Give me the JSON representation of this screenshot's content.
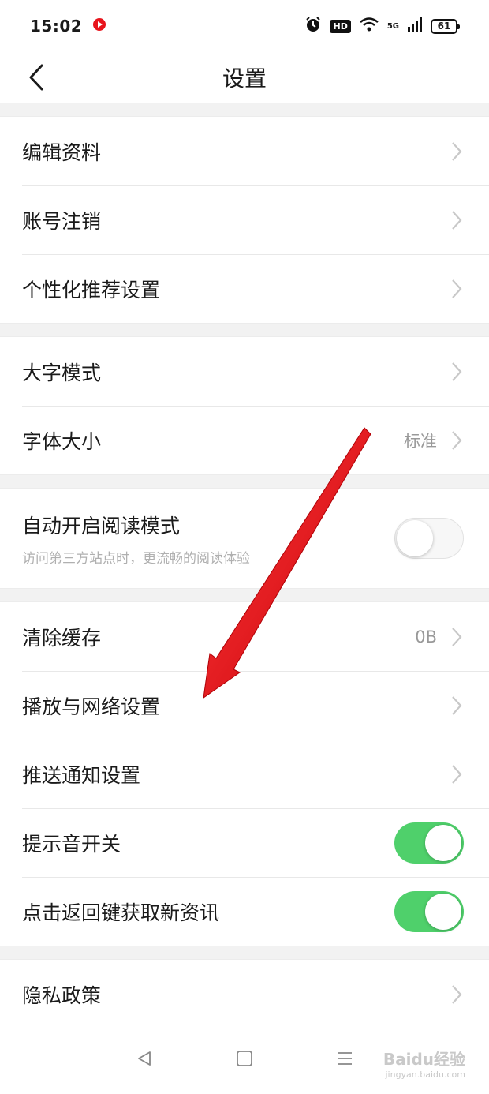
{
  "status": {
    "time": "15:02",
    "hd": "HD",
    "network": "5G",
    "battery": "61"
  },
  "nav": {
    "title": "设置"
  },
  "groups": {
    "g1": [
      {
        "label": "编辑资料"
      },
      {
        "label": "账号注销"
      },
      {
        "label": "个性化推荐设置"
      }
    ],
    "g2": [
      {
        "label": "大字模式"
      },
      {
        "label": "字体大小",
        "value": "标准"
      }
    ],
    "g3": {
      "label": "自动开启阅读模式",
      "sub": "访问第三方站点时，更流畅的阅读体验",
      "toggle": false
    },
    "g4": [
      {
        "label": "清除缓存",
        "value": "0B"
      },
      {
        "label": "播放与网络设置"
      },
      {
        "label": "推送通知设置"
      },
      {
        "label": "提示音开关",
        "toggle": true
      },
      {
        "label": "点击返回键获取新资讯",
        "toggle": true
      }
    ],
    "g5": [
      {
        "label": "隐私政策"
      }
    ]
  },
  "colors": {
    "toggle_on": "#4fd06b",
    "annotation_arrow": "#e8141c"
  },
  "watermark": {
    "brand": "Baidu经验",
    "url": "jingyan.baidu.com"
  }
}
